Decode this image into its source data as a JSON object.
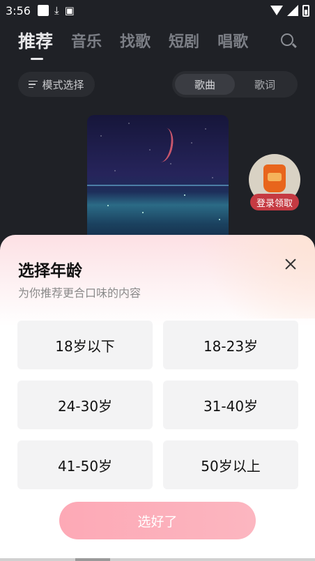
{
  "status_bar": {
    "time": "3:56",
    "icons": [
      "square-notification-icon",
      "download-icon",
      "font-icon",
      "wifi-icon",
      "signal-icon",
      "battery-icon"
    ]
  },
  "top_tabs": [
    {
      "label": "推荐",
      "active": true
    },
    {
      "label": "音乐",
      "active": false
    },
    {
      "label": "找歌",
      "active": false
    },
    {
      "label": "短剧",
      "active": false
    },
    {
      "label": "唱歌",
      "active": false
    }
  ],
  "mode_select": {
    "label": "模式选择"
  },
  "segment": {
    "items": [
      "歌曲",
      "歌词"
    ],
    "selected": "歌曲"
  },
  "gift": {
    "label": "登录领取"
  },
  "sheet": {
    "title": "选择年龄",
    "subtitle": "为你推荐更合口味的内容",
    "options": [
      "18岁以下",
      "18-23岁",
      "24-30岁",
      "31-40岁",
      "41-50岁",
      "50岁以上"
    ],
    "confirm_label": "选好了"
  },
  "colors": {
    "background": "#1f2126",
    "accent_pink": "#fda9b6",
    "gift_badge": "#c53a42"
  }
}
